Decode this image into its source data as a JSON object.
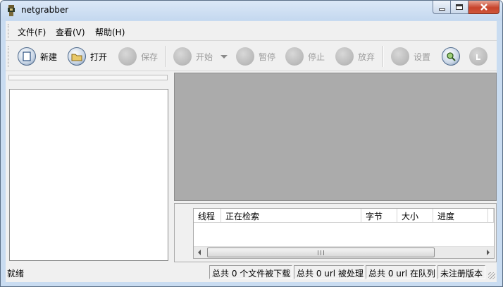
{
  "window": {
    "title": "netgrabber"
  },
  "menu": [
    {
      "label": "文件(F)"
    },
    {
      "label": "查看(V)"
    },
    {
      "label": "帮助(H)"
    }
  ],
  "toolbar": {
    "new_label": "新建",
    "open_label": "打开",
    "save_label": "保存",
    "start_label": "开始",
    "pause_label": "暂停",
    "stop_label": "停止",
    "abandon_label": "放弃",
    "settings_label": "设置"
  },
  "task_list": {
    "columns": [
      "线程",
      "正在检索",
      "字节",
      "大小",
      "进度"
    ]
  },
  "statusbar": {
    "main": "就绪",
    "files_downloaded": "总共 0 个文件被下载",
    "urls_processed": "总共 0 url 被处理",
    "urls_queued": "总共 0 url 在队列",
    "registration": "未注册版本"
  }
}
